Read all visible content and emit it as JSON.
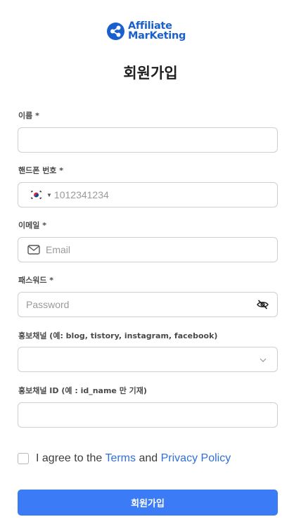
{
  "brand": {
    "line1": "Affiliate",
    "line2": "MarKeting",
    "color": "#1a5fd0"
  },
  "page_title": "회원가입",
  "fields": {
    "name": {
      "label": "이름 *",
      "value": "",
      "placeholder": ""
    },
    "phone": {
      "label": "핸드폰 번호 *",
      "flag_icon": "korea-flag-icon",
      "placeholder": "1012341234",
      "value": ""
    },
    "email": {
      "label": "이메일 *",
      "icon": "mail-icon",
      "placeholder": "Email",
      "value": ""
    },
    "password": {
      "label": "패스워드 *",
      "placeholder": "Password",
      "value": "",
      "toggle_icon": "eye-off-icon"
    },
    "channel": {
      "label": "홍보채널 (예: blog, tistory, instagram, facebook)",
      "selected": ""
    },
    "channel_id": {
      "label": "홍보채널 ID (예 : id_name 만 기재)",
      "value": "",
      "placeholder": ""
    }
  },
  "agree": {
    "checked": false,
    "prefix": "I agree to the",
    "terms": "Terms",
    "and": "and",
    "privacy": "Privacy Policy",
    "link_color": "#2f6fd6"
  },
  "submit_label": "회원가입",
  "accent": "#3b7bf6"
}
